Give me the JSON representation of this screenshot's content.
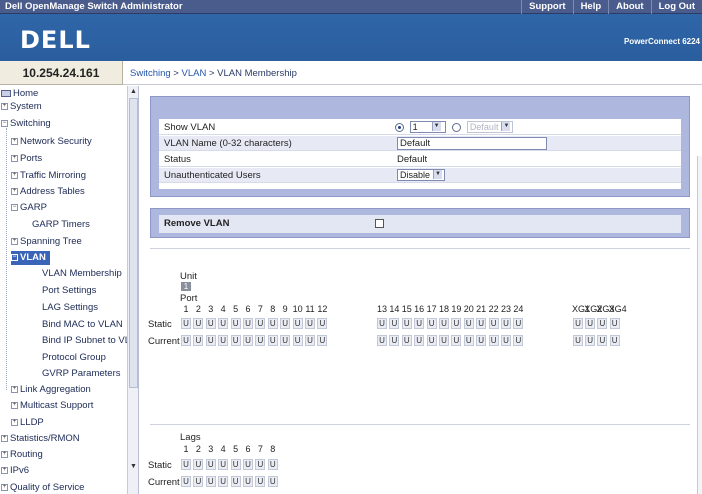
{
  "app_title": "Dell OpenManage Switch Administrator",
  "top_links": [
    "Support",
    "Help",
    "About",
    "Log Out"
  ],
  "brand": {
    "logo": "DELL",
    "model": "PowerConnect 6224"
  },
  "ip": "10.254.24.161",
  "breadcrumb": {
    "link1": "Switching",
    "sep": " > ",
    "link2": "VLAN",
    "current": "VLAN Membership"
  },
  "nav": [
    {
      "label": "Home",
      "icon": "home-icon"
    },
    {
      "label": "System",
      "icon": "expand-icon"
    },
    {
      "label": "Switching",
      "icon": "collapse-icon"
    },
    {
      "label": "Network Security",
      "icon": "expand-icon"
    },
    {
      "label": "Ports",
      "icon": "expand-icon"
    },
    {
      "label": "Traffic Mirroring",
      "icon": "expand-icon"
    },
    {
      "label": "Address Tables",
      "icon": "expand-icon"
    },
    {
      "label": "GARP",
      "icon": "collapse-icon"
    },
    {
      "label": "GARP Timers",
      "icon": ""
    },
    {
      "label": "Spanning Tree",
      "icon": "expand-icon"
    },
    {
      "label": "VLAN",
      "icon": "collapse-icon"
    },
    {
      "label": "VLAN Membership",
      "icon": ""
    },
    {
      "label": "Port Settings",
      "icon": ""
    },
    {
      "label": "LAG Settings",
      "icon": ""
    },
    {
      "label": "Bind MAC to VLAN",
      "icon": ""
    },
    {
      "label": "Bind IP Subnet to VL",
      "icon": ""
    },
    {
      "label": "Protocol Group",
      "icon": ""
    },
    {
      "label": "GVRP Parameters",
      "icon": ""
    },
    {
      "label": "Link Aggregation",
      "icon": "expand-icon"
    },
    {
      "label": "Multicast Support",
      "icon": "expand-icon"
    },
    {
      "label": "LLDP",
      "icon": "expand-icon"
    },
    {
      "label": "Statistics/RMON",
      "icon": "expand-icon"
    },
    {
      "label": "Routing",
      "icon": "expand-icon"
    },
    {
      "label": "IPv6",
      "icon": "expand-icon"
    },
    {
      "label": "Quality of Service",
      "icon": "expand-icon"
    }
  ],
  "vlan_form": {
    "show_vlan_label": "Show VLAN",
    "show_vlan_value": "1",
    "default_option": "Default",
    "vlan_name_label": "VLAN Name (0-32 characters)",
    "vlan_name_value": "Default",
    "status_label": "Status",
    "status_value": "Default",
    "unauth_label": "Unauthenticated Users",
    "unauth_value": "Disable"
  },
  "remove_vlan_label": "Remove VLAN",
  "ports_grid": {
    "unit_label": "Unit",
    "unit_value": "1",
    "port_label": "Port",
    "static_label": "Static",
    "current_label": "Current",
    "group1": [
      "1",
      "2",
      "3",
      "4",
      "5",
      "6",
      "7",
      "8",
      "9",
      "10",
      "11",
      "12"
    ],
    "group2": [
      "13",
      "14",
      "15",
      "16",
      "17",
      "18",
      "19",
      "20",
      "21",
      "22",
      "23",
      "24"
    ],
    "group3": [
      "XG1",
      "XG2",
      "XG3",
      "XG4"
    ],
    "cell_value": "U"
  },
  "lags_grid": {
    "lags_label": "Lags",
    "static_label": "Static",
    "current_label": "Current",
    "lags": [
      "1",
      "2",
      "3",
      "4",
      "5",
      "6",
      "7",
      "8"
    ],
    "cell_value": "U"
  }
}
